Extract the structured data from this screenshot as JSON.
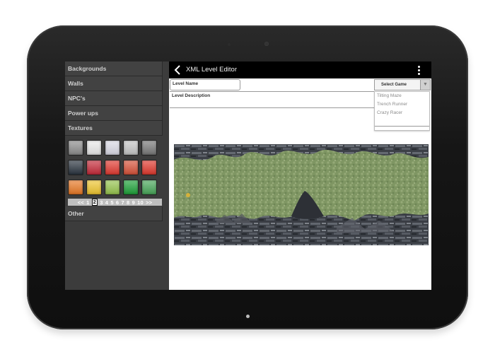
{
  "sidebar": {
    "categories": [
      "Backgrounds",
      "Walls",
      "NPC's",
      "Power ups",
      "Textures"
    ],
    "other_label": "Other",
    "swatches": [
      {
        "color": "#8e8e8e",
        "name": "swatch-gray"
      },
      {
        "color": "#ececec",
        "name": "swatch-white"
      },
      {
        "color": "#dcdce8",
        "name": "swatch-silver"
      },
      {
        "color": "#c7c7c7",
        "name": "swatch-lightgray"
      },
      {
        "color": "#7a7a7a",
        "name": "swatch-darkgray"
      },
      {
        "color": "#2b3540",
        "name": "swatch-charcoal"
      },
      {
        "color": "#c62b3a",
        "name": "swatch-crimson"
      },
      {
        "color": "#e33b32",
        "name": "swatch-red"
      },
      {
        "color": "#d8533a",
        "name": "swatch-rust"
      },
      {
        "color": "#e23a2f",
        "name": "swatch-scarlet"
      },
      {
        "color": "#ea7a26",
        "name": "swatch-orange"
      },
      {
        "color": "#f1c731",
        "name": "swatch-yellow"
      },
      {
        "color": "#98c64f",
        "name": "swatch-lime"
      },
      {
        "color": "#1fa33a",
        "name": "swatch-green"
      },
      {
        "color": "#49a85a",
        "name": "swatch-grass"
      }
    ],
    "pager": {
      "prev": "<<",
      "pages": [
        "1",
        "2",
        "3",
        "4",
        "5",
        "6",
        "7",
        "8",
        "9",
        "10"
      ],
      "current": "2",
      "next": ">>"
    }
  },
  "appbar": {
    "title": "XML Level Editor",
    "back_icon": "back-chevron-icon",
    "menu_icon": "overflow-menu-icon"
  },
  "form": {
    "level_name_label": "Level Name",
    "level_description_label": "Level Description"
  },
  "game_select": {
    "selected": "Select Game",
    "options": [
      "Tilting Maze",
      "Trench Runner",
      "Crazy Racer"
    ]
  },
  "colors": {
    "appbar": "#000000",
    "sidebar": "#3c3c3c",
    "moss": "#7c9460",
    "rock": "#3a3f46"
  }
}
